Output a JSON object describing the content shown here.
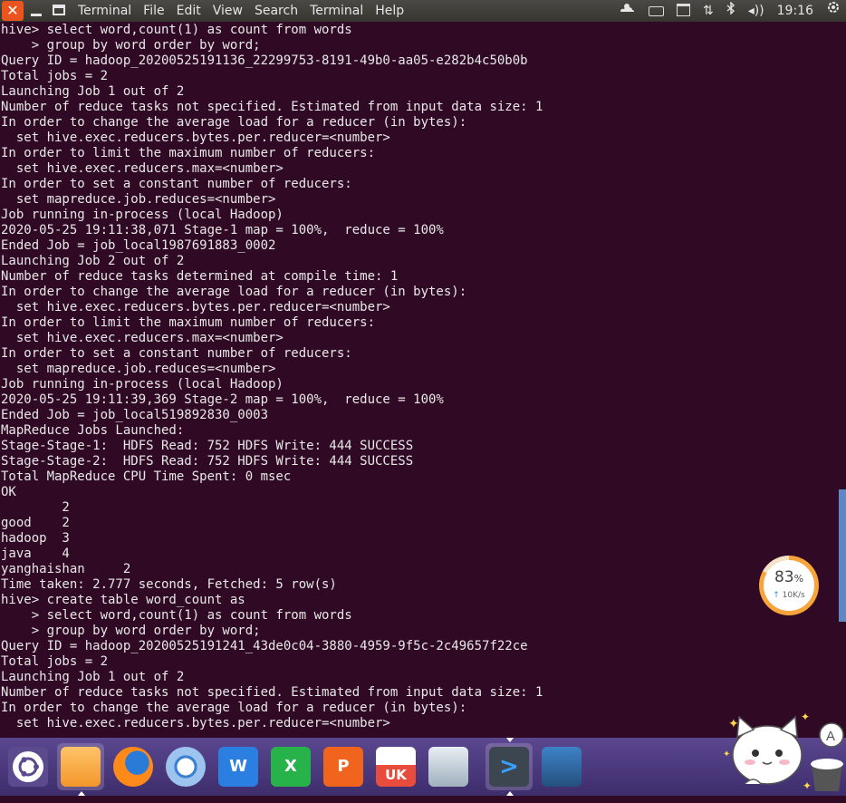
{
  "topbar": {
    "menus": [
      "Terminal",
      "File",
      "Edit",
      "View",
      "Search",
      "Terminal",
      "Help"
    ],
    "clock": "19:16",
    "close_glyph": "✕"
  },
  "terminal": {
    "lines": [
      "hive> select word,count(1) as count from words",
      "    > group by word order by word;",
      "Query ID = hadoop_20200525191136_22299753-8191-49b0-aa05-e282b4c50b0b",
      "Total jobs = 2",
      "Launching Job 1 out of 2",
      "Number of reduce tasks not specified. Estimated from input data size: 1",
      "In order to change the average load for a reducer (in bytes):",
      "  set hive.exec.reducers.bytes.per.reducer=<number>",
      "In order to limit the maximum number of reducers:",
      "  set hive.exec.reducers.max=<number>",
      "In order to set a constant number of reducers:",
      "  set mapreduce.job.reduces=<number>",
      "Job running in-process (local Hadoop)",
      "2020-05-25 19:11:38,071 Stage-1 map = 100%,  reduce = 100%",
      "Ended Job = job_local1987691883_0002",
      "Launching Job 2 out of 2",
      "Number of reduce tasks determined at compile time: 1",
      "In order to change the average load for a reducer (in bytes):",
      "  set hive.exec.reducers.bytes.per.reducer=<number>",
      "In order to limit the maximum number of reducers:",
      "  set hive.exec.reducers.max=<number>",
      "In order to set a constant number of reducers:",
      "  set mapreduce.job.reduces=<number>",
      "Job running in-process (local Hadoop)",
      "2020-05-25 19:11:39,369 Stage-2 map = 100%,  reduce = 100%",
      "Ended Job = job_local519892830_0003",
      "MapReduce Jobs Launched:",
      "Stage-Stage-1:  HDFS Read: 752 HDFS Write: 444 SUCCESS",
      "Stage-Stage-2:  HDFS Read: 752 HDFS Write: 444 SUCCESS",
      "Total MapReduce CPU Time Spent: 0 msec",
      "OK",
      "        2",
      "good    2",
      "hadoop  3",
      "java    4",
      "yanghaishan     2",
      "Time taken: 2.777 seconds, Fetched: 5 row(s)",
      "hive> create table word_count as",
      "    > select word,count(1) as count from words",
      "    > group by word order by word;",
      "Query ID = hadoop_20200525191241_43de0c04-3880-4959-9f5c-2c49657f22ce",
      "Total jobs = 2",
      "Launching Job 1 out of 2",
      "Number of reduce tasks not specified. Estimated from input data size: 1",
      "In order to change the average load for a reducer (in bytes):",
      "  set hive.exec.reducers.bytes.per.reducer=<number>"
    ]
  },
  "speed_widget": {
    "percent_value": "83",
    "percent_sign": "%",
    "rate": "10K/s",
    "arrow": "↑",
    "fill_fraction": 0.83
  },
  "dock": {
    "items": [
      {
        "name": "ubuntu-dash-icon"
      },
      {
        "name": "files-icon"
      },
      {
        "name": "firefox-icon"
      },
      {
        "name": "browser-icon"
      },
      {
        "name": "wps-writer-icon",
        "label": "W"
      },
      {
        "name": "wps-spreadsheet-icon",
        "label": "X"
      },
      {
        "name": "wps-presentation-icon",
        "label": "P"
      },
      {
        "name": "ubuntu-kylin-uk-icon",
        "label": "UK"
      },
      {
        "name": "system-monitor-icon"
      },
      {
        "name": "terminal-icon",
        "label": ">"
      },
      {
        "name": "workspace-switcher-icon"
      }
    ]
  },
  "colors": {
    "terminal_bg": "#300a24",
    "terminal_fg": "#e8e8e8",
    "topbar_bg": "#3c3b37",
    "close_button": "#e9541f",
    "dock_bg": "#4c3a7c",
    "scrollbar": "#5f87c6",
    "speed_ring": "#f7a43a"
  }
}
